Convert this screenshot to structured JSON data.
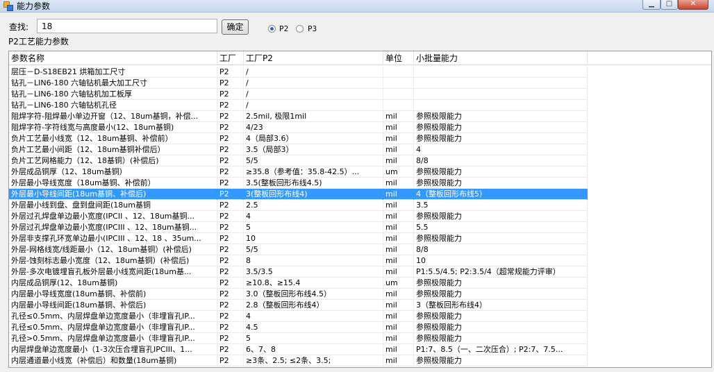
{
  "window": {
    "title": "能力参数",
    "min_label": "▁",
    "max_label": "□",
    "close_label": "✕"
  },
  "search": {
    "label": "查找:",
    "value": "18",
    "button_label": "确定"
  },
  "options": [
    {
      "label": "P2",
      "checked": true
    },
    {
      "label": "P3",
      "checked": false
    }
  ],
  "section_label": "P2工艺能力参数",
  "table": {
    "columns": [
      "参数名称",
      "工厂",
      "工厂P2",
      "单位",
      "小批量能力"
    ],
    "selected_index": 11,
    "rows": [
      [
        "层压－D-S18EB21 烘箱加工尺寸",
        "P2",
        "/",
        "",
        ""
      ],
      [
        "钻孔－LIN6-180 六轴钻机最大加工尺寸",
        "P2",
        "/",
        "",
        ""
      ],
      [
        "钻孔－LIN6-180 六轴钻机加工板厚",
        "P2",
        "/",
        "",
        ""
      ],
      [
        "钻孔－LIN6-180 六轴钻机孔径",
        "P2",
        "/",
        "",
        ""
      ],
      [
        "阻焊字符-阻焊最小单边开窗（12、18um基铜，补偿...",
        "P2",
        "2.5mil, 极限1mil",
        "mil",
        "参照极限能力"
      ],
      [
        "阻焊字符-字符线宽与高度最小(12、18um基铜)",
        "P2",
        "4/23",
        "mil",
        "参照极限能力"
      ],
      [
        "负片工艺最小线宽（12、18um基铜、补偿前）",
        "P2",
        "4（局部3.6）",
        "mil",
        "参照极限能力"
      ],
      [
        "负片工艺最小间距（12、18um基铜补偿后）",
        "P2",
        "3.5（局部3）",
        "mil",
        "4"
      ],
      [
        "负片工艺网格能力（12、18基铜）(补偿后)",
        "P2",
        "5/5",
        "mil",
        "8/8"
      ],
      [
        "外层成品铜厚（12、18um基铜）",
        "P2",
        "≥35.8（参考值：35.8-42.5）...",
        "um",
        "参照极限能力"
      ],
      [
        "外层最小导线宽度（18um基铜、补偿前）",
        "P2",
        "3.5(整板回形布线4.5)",
        "mil",
        "参照极限能力"
      ],
      [
        "外层最小导线间距(18um基铜、补偿后)",
        "P2",
        "3(整板回形布线4)",
        "mil",
        "4（整板回形布线5）"
      ],
      [
        "外层最小线到盘、盘到盘间距(18um基铜",
        "P2",
        "2.5",
        "mil",
        "3.5"
      ],
      [
        "外层过孔焊盘单边最小宽度(IPCII 、12、18um基铜...",
        "P2",
        "4",
        "mil",
        "参照极限能力"
      ],
      [
        "外层过孔焊盘单边最小宽度(IPCIII 、12、18um基铜...",
        "P2",
        "5",
        "mil",
        "5.5"
      ],
      [
        "外层非支撑孔环宽单边最小(IPCIII 、12、18 、35um...",
        "P2",
        "10",
        "mil",
        "参照极限能力"
      ],
      [
        "外层-网格线宽/线距最小（12、18um基铜）(补偿后)",
        "P2",
        "5/5",
        "mil",
        "8/8"
      ],
      [
        "外层-蚀刻标志最小宽度（12、18um基铜）(补偿后)",
        "P2",
        "8",
        "mil",
        "10"
      ],
      [
        "外层-多次电镀埋盲孔板外层最小线宽间距(18um基...",
        "P2",
        "3.5/3.5",
        "mil",
        "P1:5.5/4.5; P2:3.5/4（超常规能力评审）"
      ],
      [
        "内层成品铜厚(12、18um基铜)",
        "P2",
        "≥10.8、≥15.4",
        "um",
        "参照极限能力"
      ],
      [
        "内层最小导线宽度(18um基铜、补偿前)",
        "P2",
        "3.0（整板回形布线4.5）",
        "mil",
        "参照极限能力"
      ],
      [
        "内层最小导线间距(18um基铜、补偿后)",
        "P2",
        "2.8（整板回形布线4）",
        "mil",
        "3（整板回形布线4）"
      ],
      [
        "孔径≤0.5mm、内层焊盘单边宽度最小（非埋盲孔IP...",
        "P2",
        "4",
        "mil",
        "参照极限能力"
      ],
      [
        "孔径≤0.5mm、内层焊盘单边宽度最小（非埋盲孔IP...",
        "P2",
        "4.5",
        "mil",
        "参照极限能力"
      ],
      [
        "孔径>0.5mm、内层焊盘单边宽度最小（非埋盲孔IP...",
        "P2",
        "5",
        "mil",
        "参照极限能力"
      ],
      [
        "内层焊盘单边宽度最小（1-3次压合埋盲孔IPCIII、1...",
        "P2",
        "6、7、8",
        "mil",
        "P1:7、8.5（一、二次压合）; P2:7、7.5..."
      ],
      [
        "内层通道最小线宽（补偿后）和数量(18um基铜)",
        "P2",
        "≥3条、2.5; ≤2条、3.5;",
        "mil",
        "参照极限能力"
      ]
    ]
  }
}
